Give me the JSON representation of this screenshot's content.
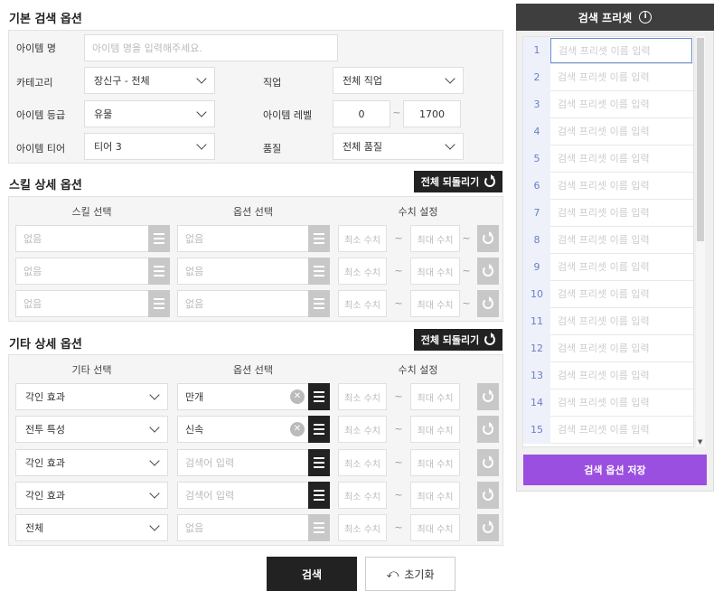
{
  "basic": {
    "title": "기본 검색 옵션",
    "item_name_label": "아이템 명",
    "item_name_placeholder": "아이템 명을 입력해주세요.",
    "category_label": "카테고리",
    "category_value": "장신구 - 전체",
    "job_label": "직업",
    "job_value": "전체 직업",
    "grade_label": "아이템 등급",
    "grade_value": "유물",
    "level_label": "아이템 레벨",
    "level_min": "0",
    "level_sep": "~",
    "level_max": "1700",
    "tier_label": "아이템 티어",
    "tier_value": "티어 3",
    "quality_label": "품질",
    "quality_value": "전체 품질"
  },
  "skill": {
    "title": "스킬 상세 옵션",
    "reset_label": "전체 되돌리기",
    "col_skill": "스킬 선택",
    "col_option": "옵션 선택",
    "col_value": "수치 설정",
    "rows": [
      {
        "skill": "없음",
        "option": "없음",
        "min": "최소 수치",
        "max": "최대 수치"
      },
      {
        "skill": "없음",
        "option": "없음",
        "min": "최소 수치",
        "max": "최대 수치"
      },
      {
        "skill": "없음",
        "option": "없음",
        "min": "최소 수치",
        "max": "최대 수치"
      }
    ]
  },
  "etc": {
    "title": "기타 상세 옵션",
    "reset_label": "전체 되돌리기",
    "col_etc": "기타 선택",
    "col_option": "옵션 선택",
    "col_value": "수치 설정",
    "rows": [
      {
        "etc": "각인 효과",
        "option": "만개",
        "min": "최소 수치",
        "max": "최대 수치"
      },
      {
        "etc": "전투 특성",
        "option": "신속",
        "min": "최소 수치",
        "max": "최대 수치"
      },
      {
        "etc": "각인 효과",
        "option": "검색어 입력",
        "min": "최소 수치",
        "max": "최대 수치"
      },
      {
        "etc": "각인 효과",
        "option": "검색어 입력",
        "min": "최소 수치",
        "max": "최대 수치"
      },
      {
        "etc": "전체",
        "option": "없음",
        "min": "최소 수치",
        "max": "최대 수치"
      }
    ]
  },
  "tilde": "~",
  "actions": {
    "search": "검색",
    "reset": "초기화"
  },
  "preset": {
    "title": "검색 프리셋",
    "info_icon": "i",
    "placeholder": "검색 프리셋 이름 입력",
    "numbers": [
      "1",
      "2",
      "3",
      "4",
      "5",
      "6",
      "7",
      "8",
      "9",
      "10",
      "11",
      "12",
      "13",
      "14",
      "15"
    ],
    "save_label": "검색 옵션 저장"
  },
  "colors": {
    "accent": "#9b4fe0",
    "dark": "#222222",
    "preset_header": "#3e3e3e"
  }
}
